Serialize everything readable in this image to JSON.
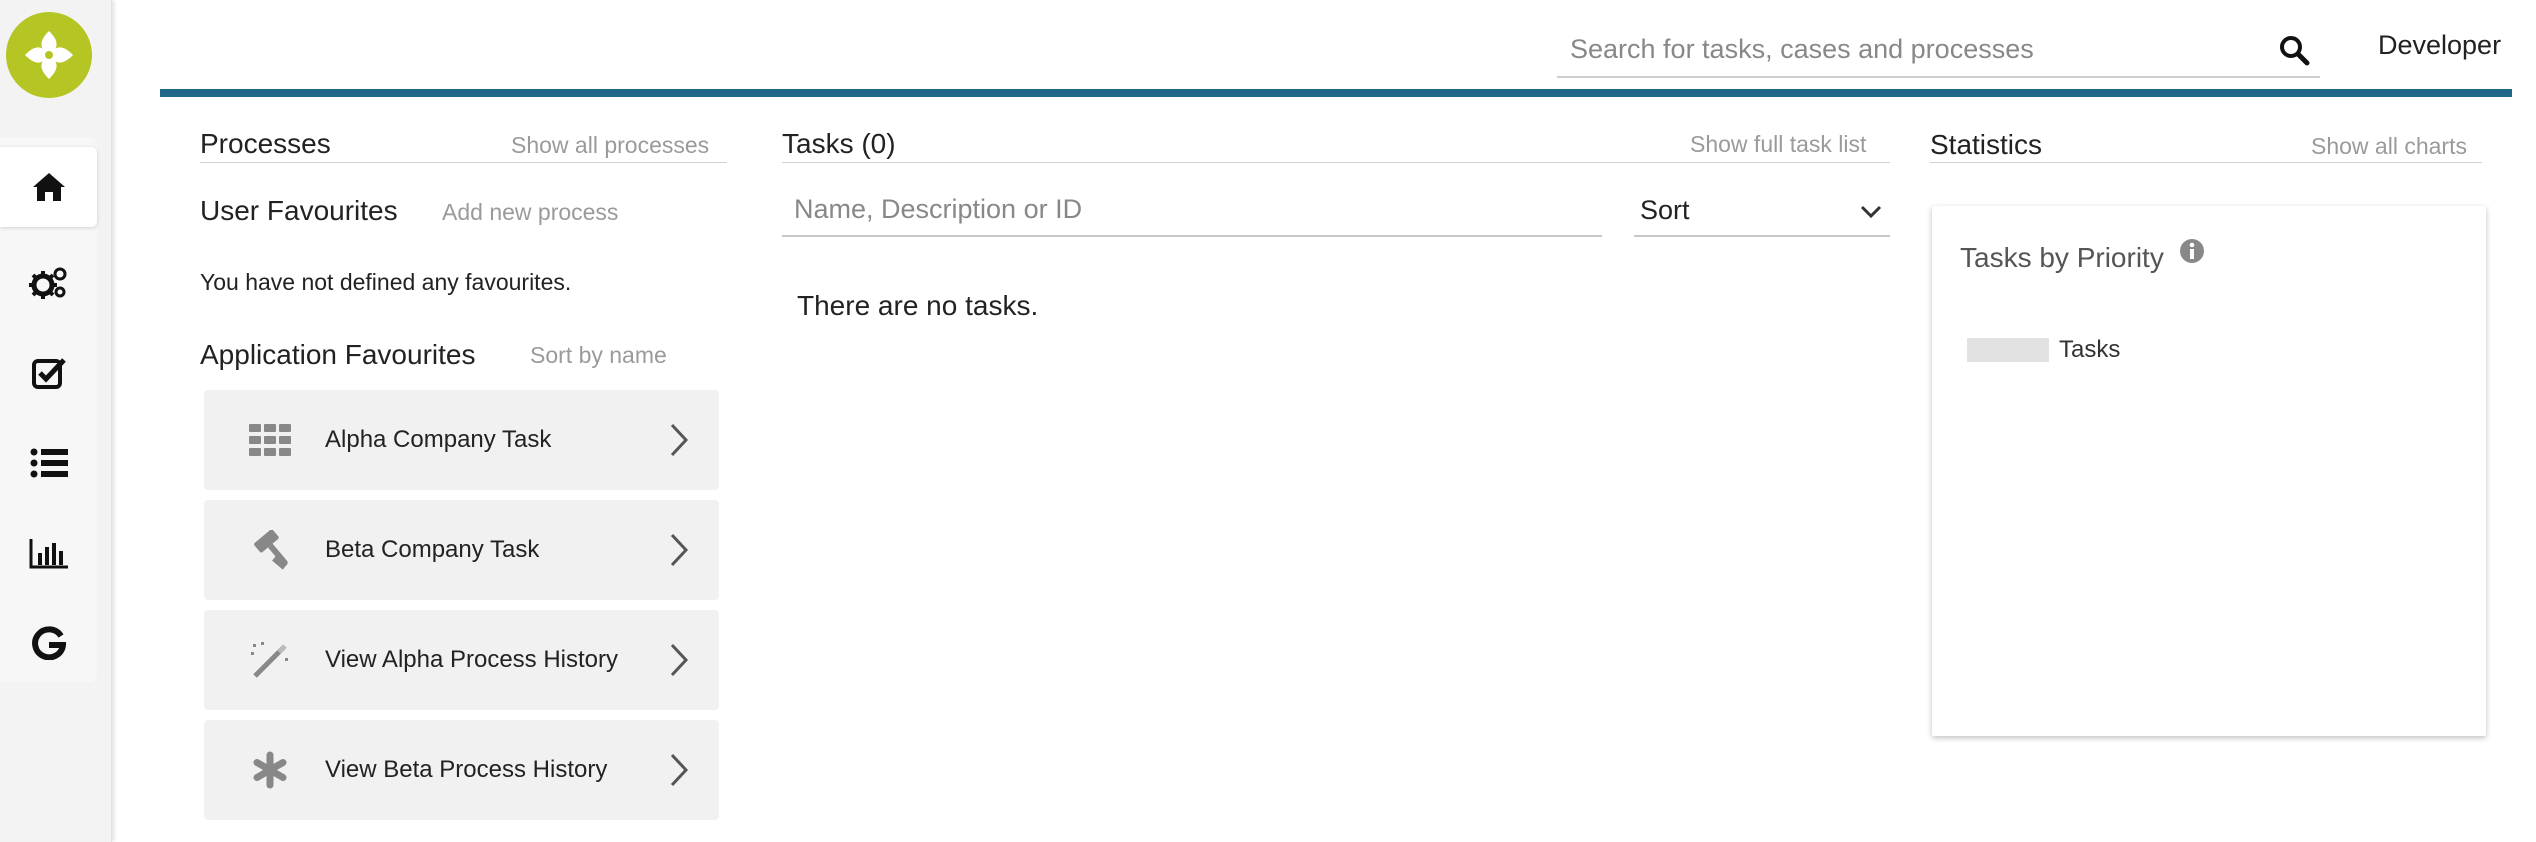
{
  "header": {
    "search_placeholder": "Search for tasks, cases and processes",
    "user_name": "Developer"
  },
  "sidebar": {
    "items": [
      {
        "icon": "home-icon"
      },
      {
        "icon": "gears-icon"
      },
      {
        "icon": "check-square-icon"
      },
      {
        "icon": "list-icon"
      },
      {
        "icon": "bar-chart-icon"
      },
      {
        "icon": "google-icon"
      }
    ]
  },
  "processes": {
    "title": "Processes",
    "show_all": "Show all processes",
    "user_favourites_title": "User Favourites",
    "add_new": "Add new process",
    "no_favourites": "You have not defined any favourites.",
    "app_favourites_title": "Application Favourites",
    "sort_by": "Sort by name",
    "favourites": [
      {
        "label": "Alpha Company Task",
        "icon": "grid-icon"
      },
      {
        "label": "Beta Company Task",
        "icon": "gavel-icon"
      },
      {
        "label": "View Alpha Process History",
        "icon": "magic-wand-icon"
      },
      {
        "label": "View Beta Process History",
        "icon": "asterisk-icon"
      }
    ]
  },
  "tasks": {
    "title": "Tasks (0)",
    "show_full": "Show full task list",
    "filter_placeholder": "Name, Description or ID",
    "sort_label": "Sort",
    "empty_message": "There are no tasks."
  },
  "statistics": {
    "title": "Statistics",
    "show_all": "Show all charts",
    "card_title": "Tasks by Priority",
    "legend_label": "Tasks"
  },
  "colors": {
    "accent_bar": "#1e6989",
    "logo": "#b5c624"
  }
}
